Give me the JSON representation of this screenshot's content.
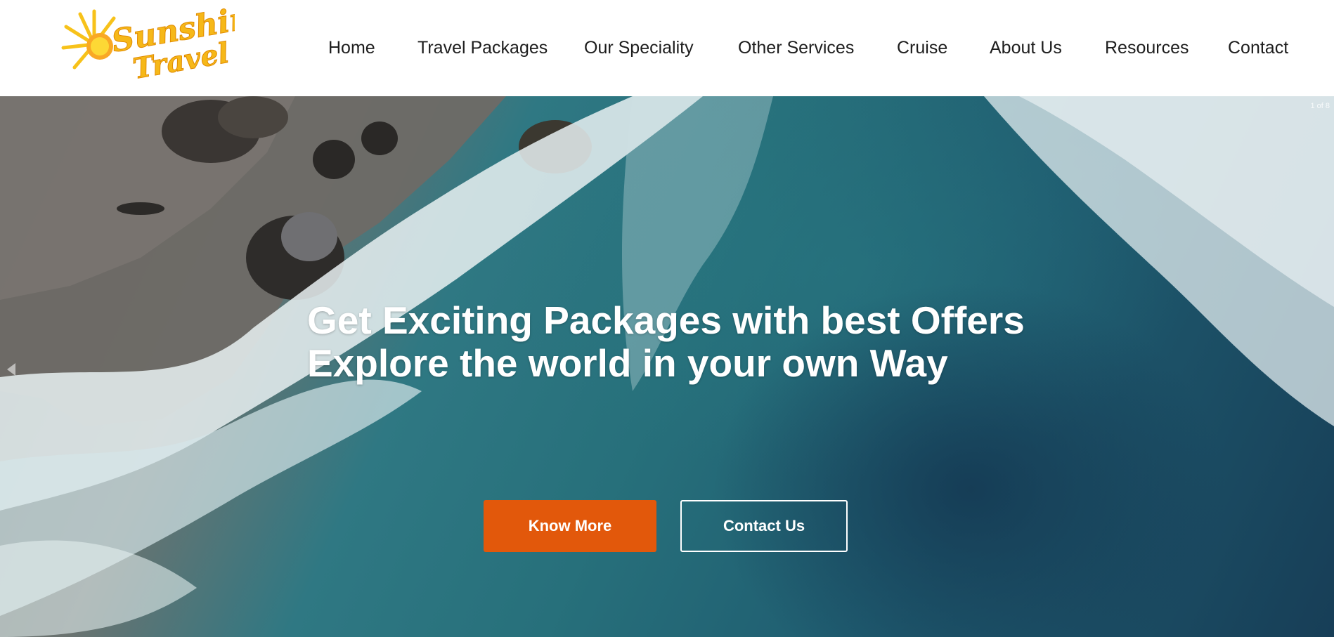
{
  "header": {
    "logo_text_line1": "Sunshine",
    "logo_text_line2": "Travel",
    "nav": [
      {
        "label": "Home"
      },
      {
        "label": "Travel Packages"
      },
      {
        "label": "Our Speciality"
      },
      {
        "label": "Other Services"
      },
      {
        "label": "Cruise"
      },
      {
        "label": "About Us"
      },
      {
        "label": "Resources"
      },
      {
        "label": "Contact"
      }
    ]
  },
  "hero": {
    "slide_counter": "1 of 8",
    "headline_line1": "Get Exciting Packages with best Offers",
    "headline_line2": "Explore the world in your own Way",
    "buttons": {
      "primary_label": "Know More",
      "secondary_label": "Contact Us"
    }
  },
  "colors": {
    "accent_orange": "#e2580b",
    "logo_yellow": "#f7c21a",
    "nav_text": "#1d1d1d"
  }
}
